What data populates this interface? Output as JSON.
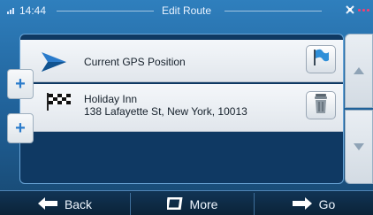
{
  "status_bar": {
    "time": "14:44",
    "title": "Edit Route"
  },
  "route": {
    "items": [
      {
        "label": "Current GPS Position",
        "icon": "start-arrow-icon",
        "action_icon": "flag-icon"
      },
      {
        "label_line1": "Holiday Inn",
        "label_line2": "138 Lafayette St, New York, 10013",
        "icon": "checkered-flag-icon",
        "action_icon": "trash-icon"
      }
    ],
    "add_buttons": [
      "+",
      "+"
    ]
  },
  "bottom_bar": {
    "back_label": "Back",
    "more_label": "More",
    "go_label": "Go"
  },
  "colors": {
    "accent_blue": "#2a7bcb",
    "status_dot": "#ff3b6e"
  }
}
